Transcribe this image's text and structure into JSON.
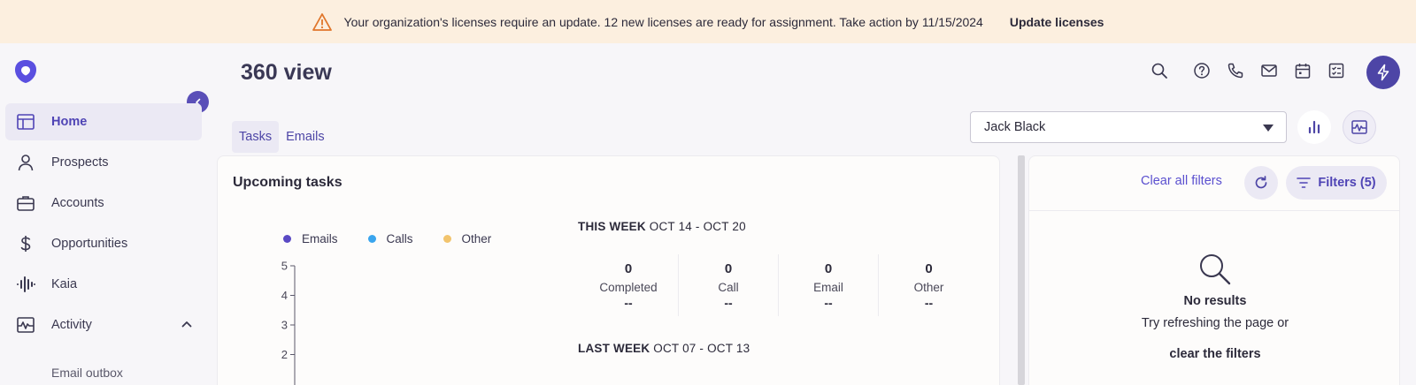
{
  "banner": {
    "message": "Your organization's licenses require an update. 12 new licenses are ready for assignment. Take action by 11/15/2024",
    "action_label": "Update licenses"
  },
  "sidebar": {
    "items": [
      {
        "label": "Home",
        "icon": "layout-icon",
        "active": true
      },
      {
        "label": "Prospects",
        "icon": "person-icon"
      },
      {
        "label": "Accounts",
        "icon": "briefcase-icon"
      },
      {
        "label": "Opportunities",
        "icon": "dollar-icon"
      },
      {
        "label": "Kaia",
        "icon": "waveform-icon"
      },
      {
        "label": "Activity",
        "icon": "activity-icon",
        "expanded": true
      }
    ],
    "sub_items": [
      {
        "label": "Email outbox"
      }
    ]
  },
  "header": {
    "title": "360 view",
    "icons": [
      "search-icon",
      "help-icon",
      "phone-icon",
      "mail-icon",
      "calendar-icon",
      "checklist-icon",
      "bolt-icon"
    ]
  },
  "tabs": [
    {
      "label": "Tasks",
      "active": true
    },
    {
      "label": "Emails"
    }
  ],
  "user_select": {
    "value": "Jack Black"
  },
  "upcoming": {
    "title": "Upcoming tasks",
    "legend": [
      {
        "label": "Emails",
        "color": "#5a49c4"
      },
      {
        "label": "Calls",
        "color": "#3aa5ee"
      },
      {
        "label": "Other",
        "color": "#f2c46d"
      }
    ],
    "this_week": {
      "label": "THIS WEEK",
      "range": "OCT 14 - OCT 20"
    },
    "stats": [
      {
        "value": "0",
        "label": "Completed",
        "sub": "--"
      },
      {
        "value": "0",
        "label": "Call",
        "sub": "--"
      },
      {
        "value": "0",
        "label": "Email",
        "sub": "--"
      },
      {
        "value": "0",
        "label": "Other",
        "sub": "--"
      }
    ],
    "last_week": {
      "label": "LAST WEEK",
      "range": "OCT 07 - OCT 13"
    }
  },
  "chart_data": {
    "type": "bar",
    "yticks": [
      "5",
      "4",
      "3",
      "2"
    ],
    "ylim": [
      0,
      5
    ],
    "series": [
      {
        "name": "Emails",
        "values": []
      },
      {
        "name": "Calls",
        "values": []
      },
      {
        "name": "Other",
        "values": []
      }
    ]
  },
  "filters_panel": {
    "clear_label": "Clear all filters",
    "filters_label": "Filters (5)",
    "empty_title": "No results",
    "empty_line": "Try refreshing the page or",
    "empty_link": "clear the filters"
  }
}
